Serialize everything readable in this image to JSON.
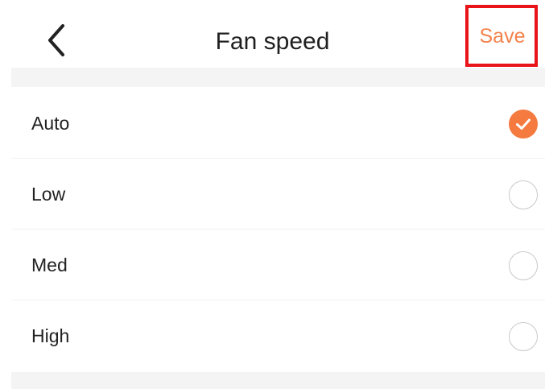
{
  "header": {
    "back_icon": "chevron-left-icon",
    "title": "Fan speed",
    "save_label": "Save"
  },
  "options": [
    {
      "label": "Auto",
      "selected": true
    },
    {
      "label": "Low",
      "selected": false
    },
    {
      "label": "Med",
      "selected": false
    },
    {
      "label": "High",
      "selected": false
    }
  ],
  "colors": {
    "accent": "#f47a3f",
    "save_text": "#f4824d",
    "highlight_box": "#e8141a",
    "section_band": "#f4f4f4",
    "radio_border": "#c9c9c9"
  }
}
